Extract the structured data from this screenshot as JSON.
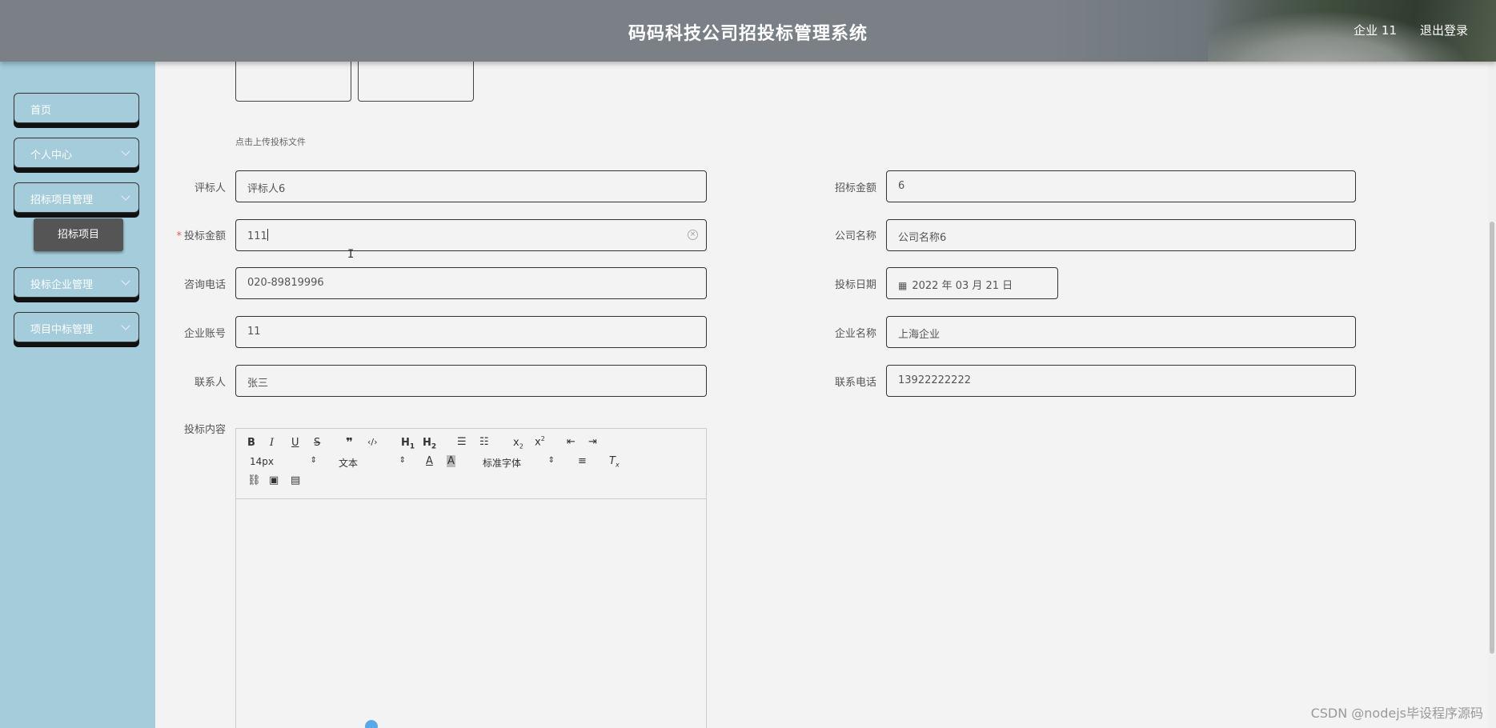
{
  "header": {
    "title": "码码科技公司招投标管理系统",
    "user": "企业 11",
    "logout": "退出登录"
  },
  "sidebar": {
    "items": [
      {
        "label": "首页",
        "has_arrow": false
      },
      {
        "label": "个人中心",
        "has_arrow": true
      },
      {
        "label": "招标项目管理",
        "has_arrow": true
      },
      {
        "label": "投标企业管理",
        "has_arrow": true
      },
      {
        "label": "项目中标管理",
        "has_arrow": true
      }
    ],
    "submenu": {
      "label": "招标项目"
    }
  },
  "form": {
    "upload_hint": "点击上传投标文件",
    "fields": {
      "reviewer": {
        "label": "评标人",
        "value": "评标人6"
      },
      "tender_amount": {
        "label": "招标金额",
        "value": "6"
      },
      "bid_amount": {
        "label": "投标金额",
        "value": "111",
        "required": "*"
      },
      "company_name": {
        "label": "公司名称",
        "value": "公司名称6"
      },
      "phone": {
        "label": "咨询电话",
        "value": "020-89819996"
      },
      "bid_date": {
        "label": "投标日期",
        "value": "2022 年 03 月 21 日"
      },
      "account": {
        "label": "企业账号",
        "value": "11"
      },
      "enterprise_name": {
        "label": "企业名称",
        "value": "上海企业"
      },
      "contact": {
        "label": "联系人",
        "value": "张三"
      },
      "contact_phone": {
        "label": "联系电话",
        "value": "13922222222"
      },
      "content": {
        "label": "投标内容"
      }
    },
    "editor": {
      "font_size": "14px",
      "text_style": "文本",
      "font_family": "标准字体"
    }
  },
  "watermark": "CSDN @nodejs毕设程序源码"
}
